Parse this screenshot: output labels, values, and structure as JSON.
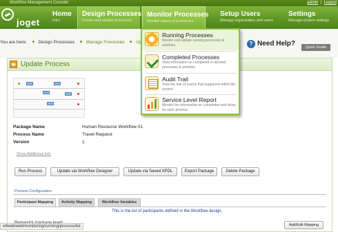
{
  "app": {
    "console_title": "Workflow Management Console",
    "logo_text": "joget",
    "user_link": "admin",
    "logout_link": "Logout"
  },
  "nav": [
    {
      "label": "Home",
      "sub": "Intro"
    },
    {
      "label": "Design Processes",
      "sub": "Create and update processes"
    },
    {
      "label": "Monitor Processes",
      "sub": "Monitor status of processes"
    },
    {
      "label": "Setup Users",
      "sub": "Manage organization and users"
    },
    {
      "label": "Settings",
      "sub": "Manage system settings"
    }
  ],
  "breadcrumb": {
    "prefix": "You are here:",
    "items": [
      "Design Processes",
      "Manage Processes",
      "Upda"
    ]
  },
  "help": {
    "label": "Need Help?",
    "quick_guide": "Quick Guide"
  },
  "page": {
    "title": "Update Process"
  },
  "process": {
    "fields": [
      {
        "key": "Package Name",
        "value": "Human Resource Workflow 01"
      },
      {
        "key": "Process Name",
        "value": "Travel Request"
      },
      {
        "key": "Version",
        "value": "1"
      }
    ],
    "show_additional": "Show Additional Info"
  },
  "actions": [
    "Run Process",
    "Update via Workflow Designer",
    "Update via Saved XPDL",
    "Export Package",
    "Delete Package"
  ],
  "config": {
    "section_label": "Process Configuration",
    "tabs": [
      "Participant Mapping",
      "Activity Mapping",
      "Workflow Variables"
    ],
    "message": "This is the list of participants defined in the Workflow design.",
    "requestor": "Requestor (package level)",
    "add_edit": "Add/Edit Mapping"
  },
  "monitor_menu": [
    {
      "title": "Running Processes",
      "desc": "Monitor and update running processes & activities",
      "icon": "running-icon"
    },
    {
      "title": "Completed Processes",
      "desc": "View information on completed or aborted processes & activities",
      "icon": "completed-icon"
    },
    {
      "title": "Audit Trail",
      "desc": "View the trail of events that happened within the system",
      "icon": "audit-icon"
    },
    {
      "title": "Service Level Report",
      "desc": "Monitor the information on completion and delay for each process",
      "icon": "report-icon"
    }
  ],
  "status_bar": "wfweb/web/monitoring/running/process/list",
  "colors": {
    "brand_green": "#5d9424",
    "menu_border": "#8dc13f",
    "link_blue": "#1b3d9a"
  }
}
